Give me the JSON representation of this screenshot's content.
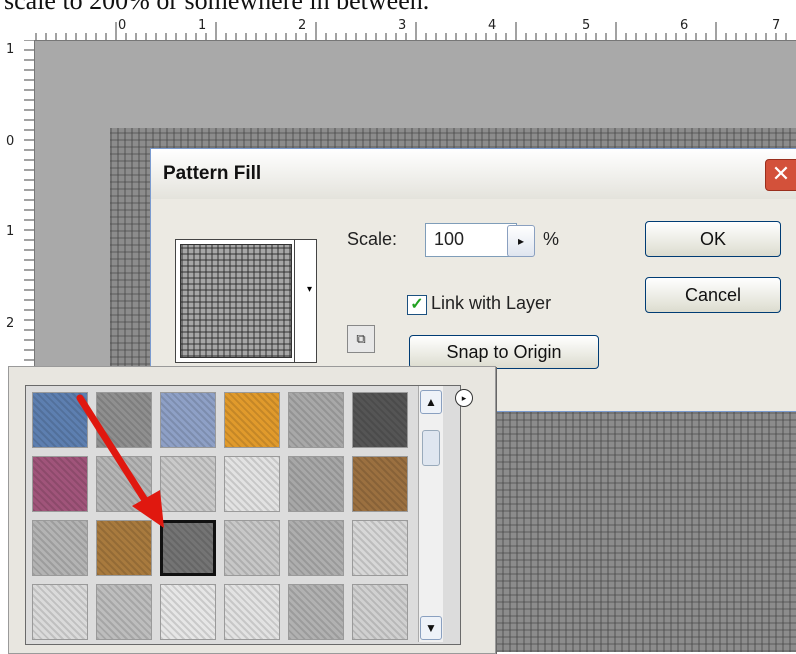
{
  "caption": "scale to 200% or somewhere in between.",
  "rulers": {
    "top_labels": [
      "0",
      "1",
      "2",
      "3",
      "4",
      "5",
      "6",
      "7"
    ],
    "left_labels": [
      "1",
      "0",
      "1",
      "2"
    ]
  },
  "dialog": {
    "title": "Pattern Fill",
    "close_glyph": "✕",
    "scale_label": "Scale:",
    "scale_value": "100",
    "scale_unit": "%",
    "stepper_glyph": "▸",
    "link_with_layer_label": "Link with Layer",
    "link_with_layer_checked": true,
    "snap_to_origin_label": "Snap to Origin",
    "ok_label": "OK",
    "cancel_label": "Cancel",
    "preview_arrow": "▾",
    "new_preset_glyph": "⧉"
  },
  "picker": {
    "scroll_up": "▲",
    "scroll_down": "▼",
    "menu_glyph": "▸",
    "selected_index": 14,
    "swatches": [
      {
        "name": "blue-bubbles",
        "color": "#5d7fb0"
      },
      {
        "name": "gray-stones",
        "color": "#8f8f8f"
      },
      {
        "name": "blue-fabric",
        "color": "#8ea0c6"
      },
      {
        "name": "orange-paper",
        "color": "#e09a2c"
      },
      {
        "name": "marble",
        "color": "#a8a8a8"
      },
      {
        "name": "checker",
        "color": "#555555"
      },
      {
        "name": "colorful-cubes",
        "color": "#a0547a"
      },
      {
        "name": "gray-scribble",
        "color": "#b5b5b5"
      },
      {
        "name": "white-noise",
        "color": "#c9c9c9"
      },
      {
        "name": "dots-line",
        "color": "#e2e2e2"
      },
      {
        "name": "gray-crumble",
        "color": "#a7a7a7"
      },
      {
        "name": "brown-canvas",
        "color": "#9b7040"
      },
      {
        "name": "gray-smudge",
        "color": "#b3b3b3"
      },
      {
        "name": "brown-burlap",
        "color": "#a87a3e"
      },
      {
        "name": "dark-weave",
        "color": "#747474"
      },
      {
        "name": "light-gray",
        "color": "#c7c7c7"
      },
      {
        "name": "gray-weave",
        "color": "#aeaeae"
      },
      {
        "name": "pale-gray",
        "color": "#d7d7d7"
      },
      {
        "name": "pale-noise",
        "color": "#dadada"
      },
      {
        "name": "gray-grain",
        "color": "#bdbdbd"
      },
      {
        "name": "white-texture",
        "color": "#e6e6e6"
      },
      {
        "name": "grid-lines",
        "color": "#e2e2e2"
      },
      {
        "name": "mid-weave",
        "color": "#b1b1b1"
      },
      {
        "name": "fine-weave",
        "color": "#d0d0d0"
      }
    ]
  },
  "colors": {
    "highlight_arrow": "#e0180f",
    "close_button": "#d3513a"
  }
}
